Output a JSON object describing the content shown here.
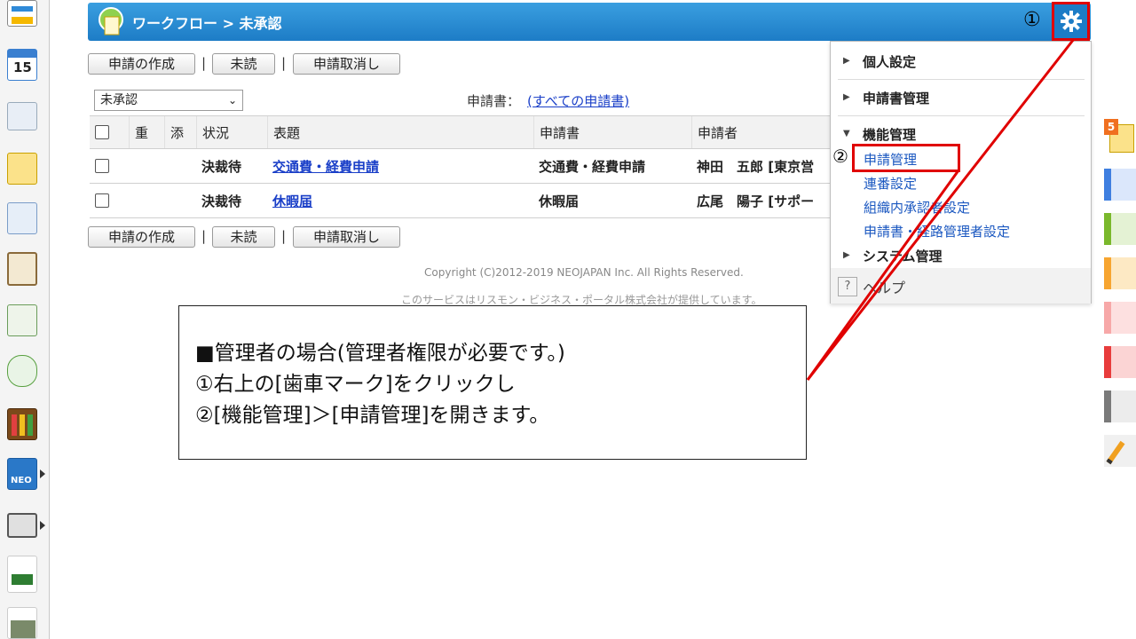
{
  "header": {
    "title": "ワークフロー > 未承認",
    "marker_1": "①"
  },
  "toolbar": {
    "create_label": "申請の作成",
    "unread_label": "未読",
    "cancel_label": "申請取消し",
    "separator": "|"
  },
  "filter": {
    "status_value": "未承認",
    "form_label": "申請書：",
    "form_link": "(すべての申請書)"
  },
  "table": {
    "headers": [
      "重",
      "添",
      "状況",
      "表題",
      "申請書",
      "申請者"
    ],
    "rows": [
      {
        "status": "決裁待",
        "title": "交通費・経費申請",
        "form": "交通費・経費申請",
        "applicant": "神田　五郎 [東京営"
      },
      {
        "status": "決裁待",
        "title": "休暇届",
        "form": "休暇届",
        "applicant": "広尾　陽子 [サポー"
      }
    ]
  },
  "footer": {
    "copyright": "Copyright (C)2012-2019 NEOJAPAN Inc. All Rights Reserved.",
    "service": "このサービスはリスモン・ビジネス・ポータル株式会社が提供しています。"
  },
  "menu": {
    "personal": "個人設定",
    "form_admin": "申請書管理",
    "function_admin": "機能管理",
    "sub_items": [
      "申請管理",
      "連番設定",
      "組織内承認者設定",
      "申請書・経路管理者設定"
    ],
    "system_admin": "システム管理",
    "help": "ヘルプ",
    "marker_2": "②"
  },
  "callout": {
    "line1": "■管理者の場合(管理者権限が必要です。)",
    "line2": "①右上の[歯車マーク]をクリックし",
    "line3": "②[機能管理]＞[申請管理]を開きます。"
  },
  "right_tabs": {
    "badge": "5"
  },
  "left_icons": {
    "calendar_day": "15",
    "neo_label": "NEO"
  },
  "colors": {
    "header_blue": "#1d7cc6",
    "highlight_red": "#e00000",
    "link_blue": "#1a3fc8"
  }
}
